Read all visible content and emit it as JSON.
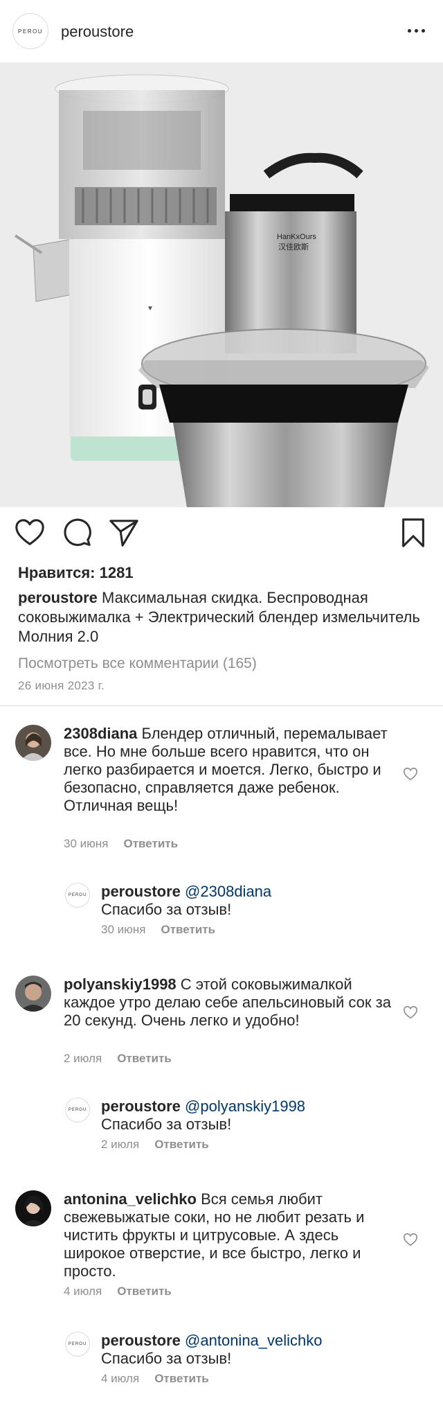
{
  "header": {
    "logo_text": "PEROU",
    "username": "peroustore"
  },
  "post": {
    "likes": "Нравится: 1281",
    "caption_user": "peroustore",
    "caption_text": "Максимальная скидка. Беспроводная соковыжималка + Электрический блендер измельчитель Молния 2.0",
    "view_all": "Посмотреть все комментарии (165)",
    "date": "26 июня 2023 г.",
    "product_brands": [
      "HanKxOurs",
      "汉佳欧斯"
    ]
  },
  "comments": [
    {
      "user": "2308diana",
      "text": "Блендер отличный, перемалывает все. Но мне больше всего нравится, что он легко разбирается и моется. Легко, быстро и безопасно, справляется даже ребенок. Отличная вещь!",
      "date": "30 июня",
      "reply_label": "Ответить",
      "reply": {
        "user": "peroustore",
        "mention": "@2308diana",
        "text": "Спасибо за отзыв!",
        "date": "30 июня",
        "reply_label": "Ответить"
      }
    },
    {
      "user": "polyanskiy1998",
      "text": "С этой соковыжималкой каждое утро делаю себе апельсиновый сок за 20 секунд. Очень легко и удобно!",
      "date": "2 июля",
      "reply_label": "Ответить",
      "reply": {
        "user": "peroustore",
        "mention": "@polyanskiy1998",
        "text": "Спасибо за отзыв!",
        "date": "2 июля",
        "reply_label": "Ответить"
      }
    },
    {
      "user": "antonina_velichko",
      "text": "Вся семья любит свежевыжатые соки, но не любит резать и чистить фрукты и цитрусовые. А здесь широкое отверстие, и все быстро, легко и просто.",
      "date": "4 июля",
      "reply_label": "Ответить",
      "reply": {
        "user": "peroustore",
        "mention": "@antonina_velichko",
        "text": "Спасибо за отзыв!",
        "date": "4 июля",
        "reply_label": "Ответить"
      }
    }
  ],
  "icons": {
    "like": "heart-icon",
    "comment": "comment-icon",
    "share": "paper-plane-icon",
    "save": "bookmark-icon",
    "more": "more-horizontal-icon"
  },
  "colors": {
    "text": "#262626",
    "muted": "#8e8e8e",
    "mention": "#00376b",
    "divider": "#dbdbdb"
  }
}
